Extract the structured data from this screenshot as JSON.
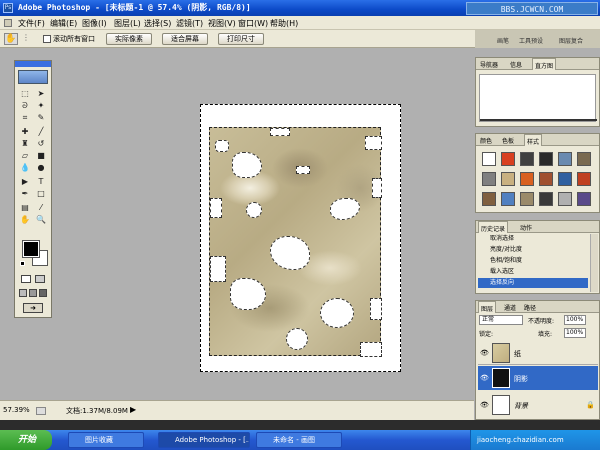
{
  "window": {
    "title": "Adobe Photoshop - [未标题-1 @ 57.4% (阴影, RGB/8)]",
    "watermark": "BBS.JCWCN.COM"
  },
  "menu": [
    "文件(F)",
    "编辑(E)",
    "图像(I)",
    "图层(L)",
    "选择(S)",
    "滤镜(T)",
    "视图(V)",
    "窗口(W)",
    "帮助(H)"
  ],
  "options": {
    "checkbox_label": "滚动所有窗口",
    "actual_pixels": "实际像素",
    "fit_screen": "适合屏幕",
    "print_size": "打印尺寸"
  },
  "palette_well": [
    "画笔",
    "工具预设",
    "图层复合"
  ],
  "navigator": {
    "tabs": [
      "导航器",
      "信息",
      "直方图"
    ]
  },
  "styles": {
    "tabs": [
      "颜色",
      "色板",
      "样式"
    ],
    "swatches": [
      "#ffffff",
      "#d84020",
      "#404040",
      "#2a2a2a",
      "#6a8ab0",
      "#7a6a50",
      "#808080",
      "#c8b080",
      "#d86020",
      "#a05030",
      "#3060a0",
      "#c04020",
      "#806040",
      "#5080c0",
      "#9a8a6a",
      "#3a3a3a",
      "#b0b0b0",
      "#5a4a8a"
    ]
  },
  "history": {
    "tabs": [
      "历史记录",
      "动作"
    ],
    "items": [
      "取消选择",
      "亮度/对比度",
      "色相/饱和度",
      "载入选区",
      "选择反向"
    ]
  },
  "layers": {
    "tabs": [
      "图层",
      "通道",
      "路径"
    ],
    "blend_mode": "正常",
    "opacity_label": "不透明度:",
    "opacity_value": "100%",
    "lock_label": "锁定:",
    "fill_label": "填充:",
    "fill_value": "100%",
    "rows": [
      {
        "name": "纸",
        "selected": false
      },
      {
        "name": "阴影",
        "selected": true
      },
      {
        "name": "背景",
        "selected": false
      }
    ]
  },
  "status": {
    "zoom": "57.39%",
    "doc": "文档:1.37M/8.09M"
  },
  "taskbar": {
    "start": "开始",
    "tasks": [
      "图片收藏",
      "Adobe Photoshop - [...",
      "未命名 - 画图"
    ],
    "tray_text": "jiaocheng.chazidian.com"
  },
  "colors": {
    "xp_blue": "#0c4ac8",
    "chrome": "#ece9d8",
    "workspace": "#b0b0b0",
    "selected_row": "#3169c6",
    "paper": "#c8bd98"
  }
}
